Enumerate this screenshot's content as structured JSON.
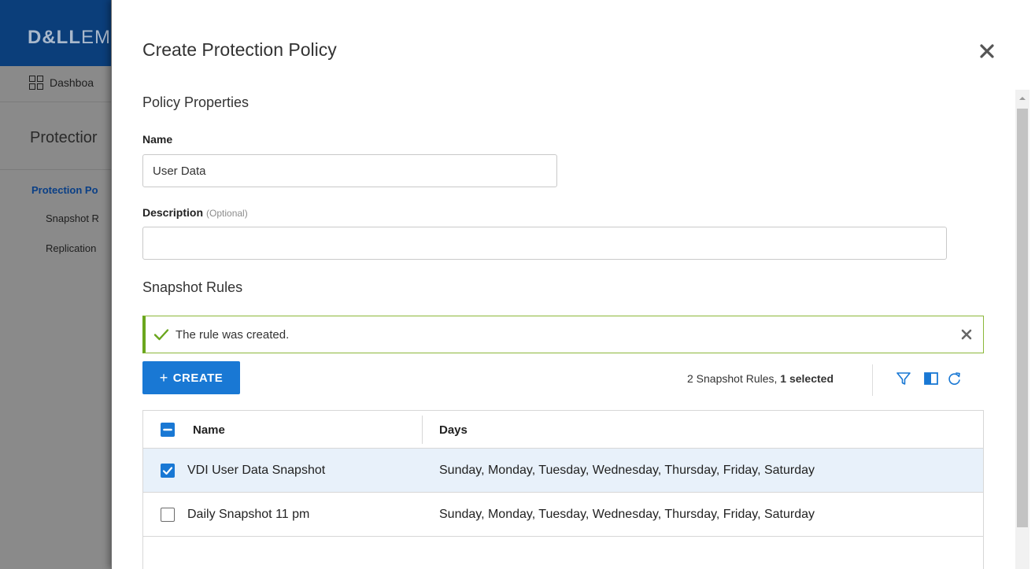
{
  "background": {
    "logo_bold": "D&LL",
    "logo_rest": "EM",
    "nav_item": "Dashboa",
    "section_title": "Protectior",
    "sidebar_active": "Protection Po",
    "sidebar_items": [
      "Snapshot R",
      "Replication"
    ]
  },
  "modal": {
    "title": "Create Protection Policy",
    "close_icon": "close-icon",
    "properties_heading": "Policy Properties",
    "name_label": "Name",
    "name_value": "User Data",
    "description_label": "Description",
    "description_optional": "(Optional)",
    "description_value": "",
    "rules_heading": "Snapshot Rules",
    "banner": {
      "text": "The rule was created.",
      "icon": "check-icon",
      "color": "#6aa61d"
    },
    "toolbar": {
      "create_label": "CREATE",
      "count_prefix": "2 Snapshot Rules,",
      "count_selected": "1 selected",
      "icons": [
        "filter-icon",
        "columns-icon",
        "refresh-icon"
      ]
    },
    "table": {
      "columns": [
        "Name",
        "Days"
      ],
      "rows": [
        {
          "name": "VDI User Data Snapshot",
          "days": "Sunday, Monday, Tuesday, Wednesday, Thursday, Friday, Saturday",
          "selected": true
        },
        {
          "name": "Daily Snapshot 11 pm",
          "days": "Sunday, Monday, Tuesday, Wednesday, Thursday, Friday, Saturday",
          "selected": false
        }
      ]
    }
  },
  "colors": {
    "accent": "#1978d4",
    "header": "#0b3e7a",
    "selected_row": "#e8f1fa"
  }
}
